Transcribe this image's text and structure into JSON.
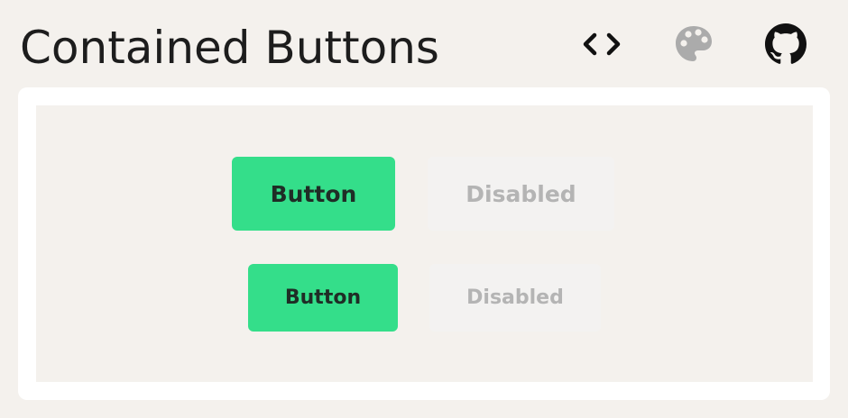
{
  "header": {
    "title": "Contained Buttons"
  },
  "toolbar": {
    "items": [
      {
        "icon": "code-icon",
        "glyph": "‹›"
      },
      {
        "icon": "palette-icon"
      },
      {
        "icon": "github-icon"
      }
    ]
  },
  "demo": {
    "rows": [
      {
        "primary_label": "Button",
        "disabled_label": "Disabled"
      },
      {
        "primary_label": "Button",
        "disabled_label": "Disabled"
      }
    ]
  },
  "colors": {
    "background": "#f4f1ed",
    "primary": "#34de8a",
    "primary_text": "#1f2d26",
    "disabled_bg": "#f3f2f1",
    "disabled_text": "#b4b4b4"
  }
}
